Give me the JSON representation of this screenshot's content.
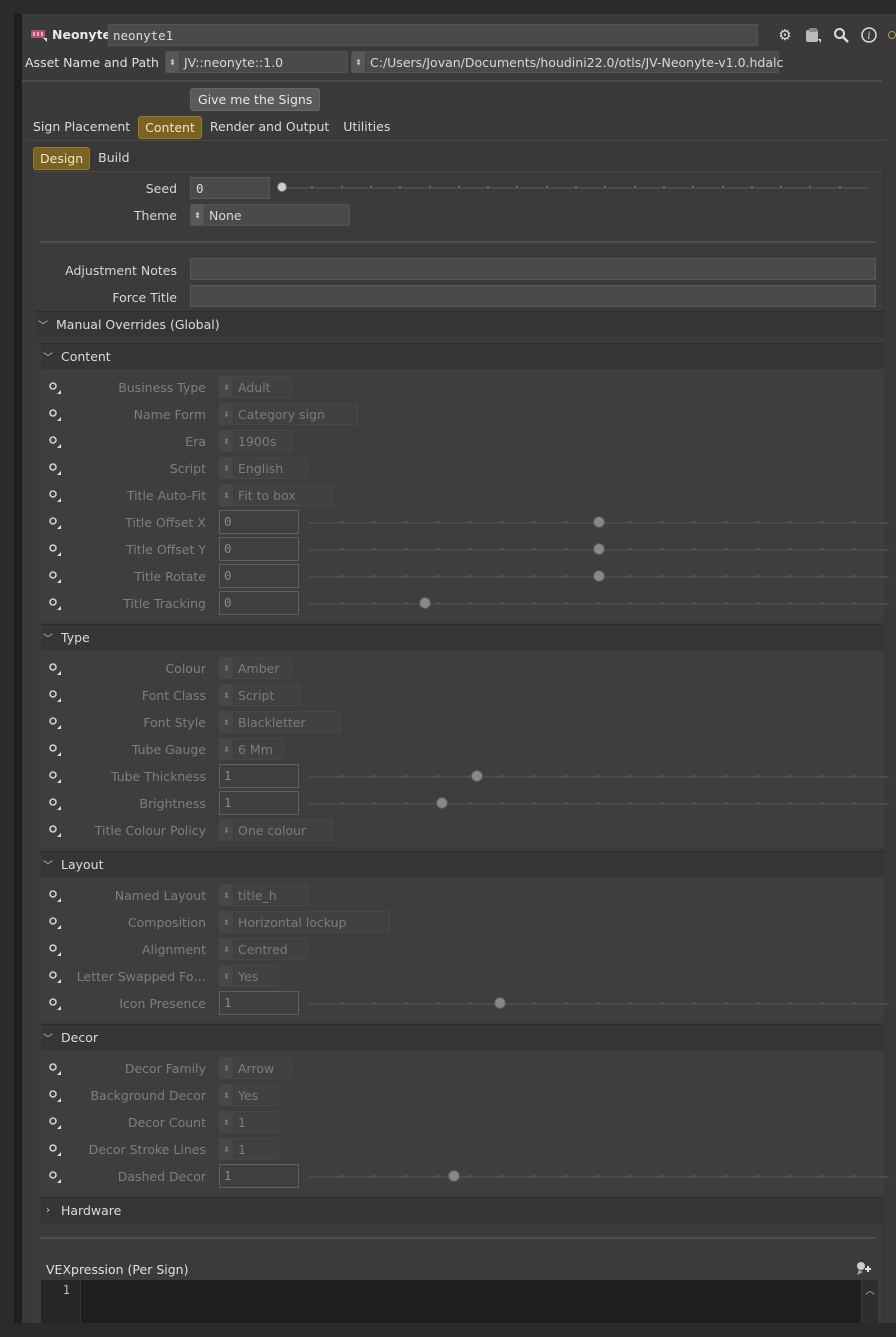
{
  "header": {
    "node_type": "Neonyte",
    "node_name": "neonyte1",
    "icons": [
      "gear-icon",
      "help-card-icon",
      "search-icon",
      "info-icon",
      "status-icon"
    ]
  },
  "asset": {
    "label": "Asset Name and Path",
    "name": "JV::neonyte::1.0",
    "path": "C:/Users/Jovan/Documents/houdini22.0/otls/JV-Neonyte-v1.0.hdalc"
  },
  "action_button": "Give me the Signs",
  "main_tabs": [
    {
      "label": "Sign Placement",
      "active": false
    },
    {
      "label": "Content",
      "active": true
    },
    {
      "label": "Render and Output",
      "active": false
    },
    {
      "label": "Utilities",
      "active": false
    }
  ],
  "sub_tabs": [
    {
      "label": "Design",
      "active": true
    },
    {
      "label": "Build",
      "active": false
    }
  ],
  "seed": {
    "label": "Seed",
    "value": "0",
    "slider": 0.0
  },
  "theme": {
    "label": "Theme",
    "value": "None"
  },
  "adjustment_notes": {
    "label": "Adjustment Notes",
    "value": ""
  },
  "force_title": {
    "label": "Force Title",
    "value": ""
  },
  "manual_overrides": {
    "label": "Manual Overrides (Global)",
    "expanded": true
  },
  "sections": {
    "content": {
      "label": "Content",
      "params": [
        {
          "label": "Business Type",
          "kind": "menu",
          "value": "Adult"
        },
        {
          "label": "Name Form",
          "kind": "menu",
          "value": "Category sign"
        },
        {
          "label": "Era",
          "kind": "menu",
          "value": "1900s"
        },
        {
          "label": "Script",
          "kind": "menu",
          "value": "English"
        },
        {
          "label": "Title Auto-Fit",
          "kind": "menu",
          "value": "Fit to box"
        },
        {
          "label": "Title Offset X",
          "kind": "slider",
          "value": "0",
          "slider": 0.5
        },
        {
          "label": "Title Offset Y",
          "kind": "slider",
          "value": "0",
          "slider": 0.5
        },
        {
          "label": "Title Rotate",
          "kind": "slider",
          "value": "0",
          "slider": 0.5
        },
        {
          "label": "Title Tracking",
          "kind": "slider",
          "value": "0",
          "slider": 0.2
        }
      ]
    },
    "type": {
      "label": "Type",
      "params": [
        {
          "label": "Colour",
          "kind": "menu",
          "value": "Amber"
        },
        {
          "label": "Font Class",
          "kind": "menu",
          "value": "Script"
        },
        {
          "label": "Font Style",
          "kind": "menu",
          "value": "Blackletter"
        },
        {
          "label": "Tube Gauge",
          "kind": "menu",
          "value": "6 Mm"
        },
        {
          "label": "Tube Thickness",
          "kind": "slider",
          "value": "1",
          "slider": 0.29
        },
        {
          "label": "Brightness",
          "kind": "slider",
          "value": "1",
          "slider": 0.23
        },
        {
          "label": "Title Colour Policy",
          "kind": "menu",
          "value": "One colour"
        }
      ]
    },
    "layout": {
      "label": "Layout",
      "params": [
        {
          "label": "Named Layout",
          "kind": "menu",
          "value": "title_h"
        },
        {
          "label": "Composition",
          "kind": "menu",
          "value": "Horizontal lockup"
        },
        {
          "label": "Alignment",
          "kind": "menu",
          "value": "Centred"
        },
        {
          "label": "Letter Swapped Fo…",
          "kind": "menu",
          "value": "Yes"
        },
        {
          "label": "Icon Presence",
          "kind": "slider",
          "value": "1",
          "slider": 0.33
        }
      ]
    },
    "decor": {
      "label": "Decor",
      "params": [
        {
          "label": "Decor Family",
          "kind": "menu",
          "value": "Arrow"
        },
        {
          "label": "Background Decor",
          "kind": "menu",
          "value": "Yes"
        },
        {
          "label": "Decor Count",
          "kind": "menu",
          "value": "1"
        },
        {
          "label": "Decor Stroke Lines",
          "kind": "menu",
          "value": "1"
        },
        {
          "label": "Dashed Decor",
          "kind": "slider",
          "value": "1",
          "slider": 0.25
        }
      ]
    },
    "hardware": {
      "label": "Hardware"
    }
  },
  "vex": {
    "label": "VEXpression (Per Sign)",
    "line_number": "1",
    "code": ""
  }
}
